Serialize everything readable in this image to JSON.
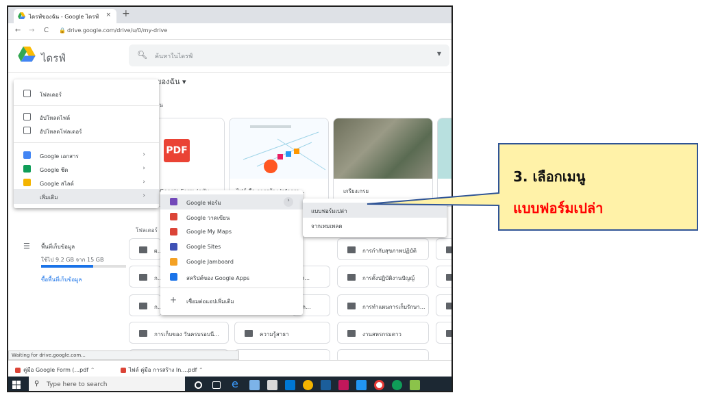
{
  "browser": {
    "tab_title": "ไดรฟ์ของฉัน - Google ไดรฟ์",
    "tab_close": "×",
    "new_tab": "+",
    "back": "←",
    "forward": "→",
    "reload": "C",
    "url": "drive.google.com/drive/u/0/my-drive"
  },
  "drive": {
    "brand": "ไดรฟ์",
    "search_placeholder": "ค้นหาในไดรฟ์",
    "breadcrumb": "ของฉัน ▾",
    "quick_access_label": "วน",
    "cards": [
      {
        "caption": "Google Form (ฉบับ..."
      },
      {
        "caption": "ไฟล์ คือ การสร้าง Infogra..."
      },
      {
        "caption": "เกรียงเกรย"
      }
    ],
    "pdf_badge": "PDF",
    "folders_label": "โฟลเดอร์",
    "folders": [
      {
        "label": "ผ..."
      },
      {
        "label": "การกำกับสุขภาพปฏิบัติ"
      },
      {
        "label": "ก..."
      },
      {
        "label": "เนต..."
      },
      {
        "label": "การตั้งปฏิบัติงานปัญญ์"
      },
      {
        "label": "ก..."
      },
      {
        "label": "บบก..."
      },
      {
        "label": "การทำแผนการเก็บรักษา..."
      },
      {
        "label": "การเก็บของ วันครบรอบนี..."
      },
      {
        "label": "ความรู้สาธา"
      },
      {
        "label": "งานสหรกรมดาว"
      }
    ],
    "storage": {
      "label": "พื้นที่เก็บข้อมูล",
      "used": "ใช้ไป 9.2 GB จาก 15 GB",
      "used_fraction": 0.61,
      "buy": "ซื้อพื้นที่เก็บข้อมูล"
    }
  },
  "new_menu": {
    "folder": "โฟลเดอร์",
    "upload_file": "อัปโหลดไฟล์",
    "upload_folder": "อัปโหลดโฟลเดอร์",
    "docs": "Google เอกสาร",
    "sheets": "Google ชีต",
    "slides": "Google สไลด์",
    "more": "เพิ่มเติม"
  },
  "more_menu": {
    "forms": "Google ฟอร์ม",
    "drawings": "Google วาดเขียน",
    "mymaps": "Google My Maps",
    "sites": "Google Sites",
    "jamboard": "Google Jamboard",
    "apps_script": "สคริปต์ของ Google Apps",
    "connect": "เชื่อมต่อแอปเพิ่มเติม"
  },
  "forms_submenu": {
    "blank": "แบบฟอร์มเปล่า",
    "template": "จากเทมเพลต"
  },
  "status_text": "Waiting for drive.google.com...",
  "downloads": [
    {
      "name": "คู่มือ Google Form (...pdf"
    },
    {
      "name": "ไฟล์ คู่มือ การสร้าง In....pdf"
    }
  ],
  "taskbar": {
    "search": "Type here to search"
  },
  "callout": {
    "step": "3. เลือกเมนู",
    "item": "แบบฟอร์มเปล่า"
  },
  "colors": {
    "callout_fill": "#fff2a8",
    "callout_item": "#ff0000",
    "docs": "#4285f4",
    "sheets": "#0f9d58",
    "slides": "#f4b400",
    "forms": "#7248b9",
    "drawings": "#db4437",
    "mymaps": "#db4437",
    "sites": "#3f51b5",
    "jamboard": "#f4a124",
    "apps_script": "#1a73e8"
  }
}
